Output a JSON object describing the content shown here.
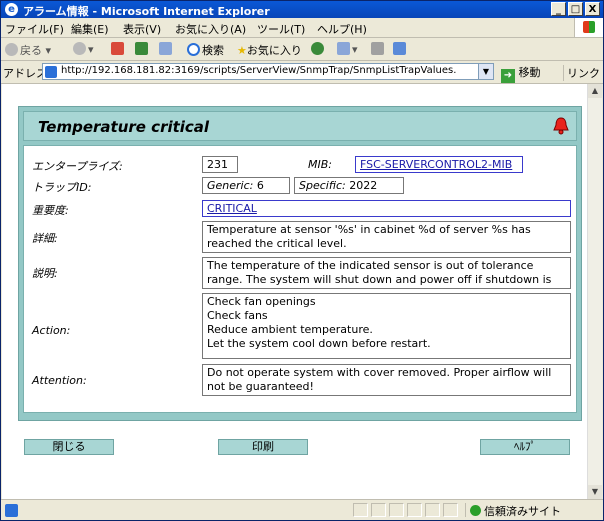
{
  "window": {
    "title": "アラーム情報 - Microsoft Internet Explorer",
    "minimize": "_",
    "maximize": "□",
    "close": "X"
  },
  "menu": [
    "ファイル(F)",
    "編集(E)",
    "表示(V)",
    "お気に入り(A)",
    "ツール(T)",
    "ヘルプ(H)"
  ],
  "toolbar": {
    "back": "戻る",
    "search": "検索",
    "favorites": "お気に入り"
  },
  "address": {
    "label": "アドレス(D)",
    "url": "http://192.168.181.82:3169/scripts/ServerView/SnmpTrap/SnmpListTrapValues.",
    "go": "移動",
    "links": "リンク »"
  },
  "alarm": {
    "title": "Temperature critical",
    "enterprise_label": "エンタープライズ:",
    "enterprise_value": "231",
    "mib_label": "MIB:",
    "mib_value": "FSC-SERVERCONTROL2-MIB",
    "trap_id_label": "トラップID:",
    "generic_label": "Generic:",
    "generic_value": "6",
    "specific_label": "Specific:",
    "specific_value": "2022",
    "severity_label": "重要度:",
    "severity_value": "CRITICAL",
    "detail_label": "詳細:",
    "detail_text": "Temperature at sensor '%s' in cabinet %d of server %s has reached the critical level.",
    "description_label": "説明:",
    "description_text": "The temperature of the indicated sensor is out of tolerance range. The system will shut down and power off if shutdown is enabled.",
    "action_label": "Action:",
    "action_lines": [
      "Check fan openings",
      "Check fans",
      "Reduce ambient temperature.",
      "Let the system cool down before restart."
    ],
    "attention_label": "Attention:",
    "attention_text": "Do not operate system with cover removed. Proper airflow will not be guaranteed!"
  },
  "buttons": {
    "close": "閉じる",
    "print": "印刷",
    "help": "ﾍﾙﾌﾟ"
  },
  "status": {
    "zone": "信頼済みサイト"
  }
}
